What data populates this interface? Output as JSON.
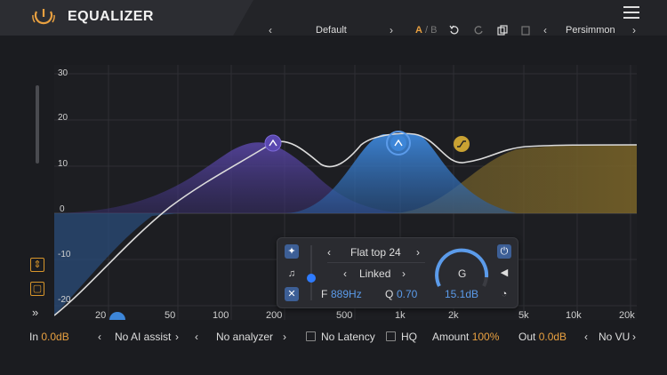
{
  "app": {
    "title": "EQUALIZER"
  },
  "toolbar": {
    "preset": "Default",
    "ab_a": "A",
    "ab_sep": "/",
    "ab_b": "B",
    "theme": "Persimmon",
    "prev": "‹",
    "next": "›"
  },
  "graph": {
    "y_labels": [
      "30",
      "20",
      "10",
      "0",
      "-10",
      "-20"
    ],
    "x_labels": [
      "20",
      "50",
      "100",
      "200",
      "500",
      "1k",
      "2k",
      "5k",
      "10k",
      "20k"
    ]
  },
  "band_panel": {
    "shape": "Flat top 24",
    "mode": "Linked",
    "freq_label": "F",
    "freq_value": "889Hz",
    "q_label": "Q",
    "q_value": "0.70",
    "gain_label": "G",
    "gain_value": "15.1dB"
  },
  "bottom": {
    "in_label": "In",
    "in_value": "0.0dB",
    "ai_assist": "No AI assist",
    "analyzer": "No analyzer",
    "latency": "No Latency",
    "hq": "HQ",
    "amount_label": "Amount",
    "amount_value": "100%",
    "out_label": "Out",
    "out_value": "0.0dB",
    "vu": "No VU"
  },
  "colors": {
    "accent": "#e8a040",
    "blue": "#5b9bea",
    "purple": "#6a55b8",
    "gold": "#c9a233"
  }
}
